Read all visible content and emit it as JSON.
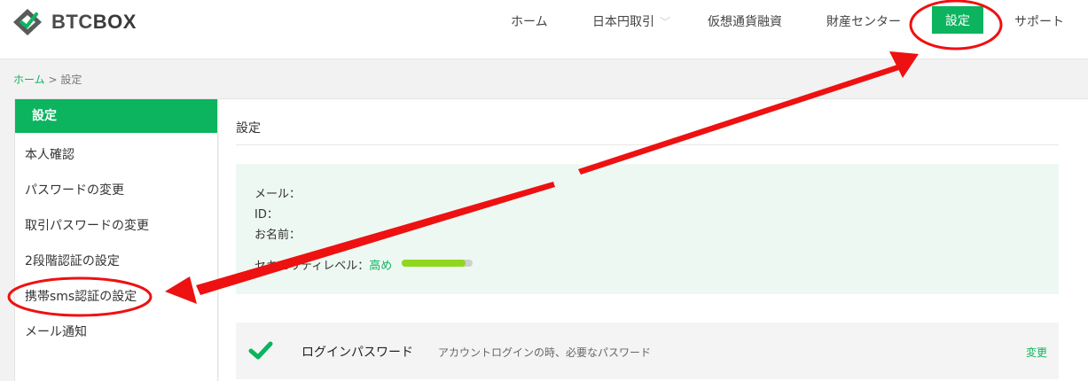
{
  "header": {
    "logo_text_a": "BTC",
    "logo_text_b": "BOX",
    "nav": {
      "home": "ホーム",
      "jpy_trade": "日本円取引",
      "crypto_lending": "仮想通貨融資",
      "asset_center": "財産センター",
      "settings": "設定",
      "support": "サポート"
    },
    "accent_color": "#0cb45f"
  },
  "breadcrumb": {
    "home": "ホーム",
    "separator": ">",
    "current": "設定"
  },
  "sidebar": {
    "title": "設定",
    "items": [
      {
        "label": "本人確認"
      },
      {
        "label": "パスワードの変更"
      },
      {
        "label": "取引パスワードの変更"
      },
      {
        "label": "2段階認証の設定"
      },
      {
        "label": "携帯sms認証の設定"
      },
      {
        "label": "メール通知"
      }
    ]
  },
  "main": {
    "title": "設定",
    "info": {
      "email_label": "メール：",
      "id_label": "ID：",
      "name_label": "お名前：",
      "security_label": "セキュリティレベル：",
      "security_value": "高め",
      "security_level": 0.9
    },
    "login_password": {
      "label": "ログインパスワード",
      "description": "アカウントログインの時、必要なパスワード",
      "action": "変更"
    }
  },
  "annotation": {
    "color": "#ee1111"
  }
}
